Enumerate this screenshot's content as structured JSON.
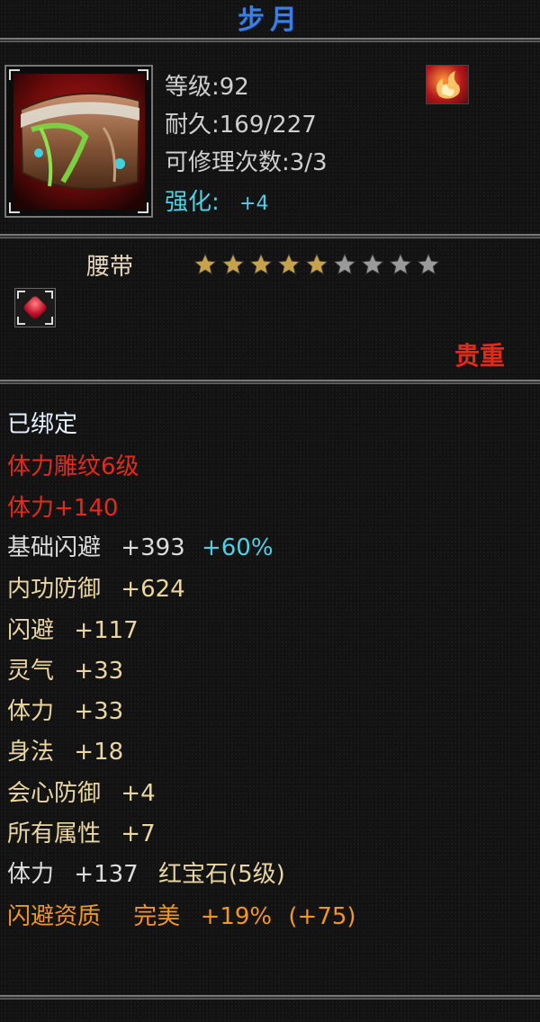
{
  "item": {
    "name": "步月",
    "type": "腰带",
    "rarity": "贵重",
    "stats": {
      "level": "等级:92",
      "durability": "耐久:169/227",
      "repairs": "可修理次数:3/3",
      "refine_label": "强化:",
      "refine_value": "+4"
    },
    "stars_total": 9,
    "stars_filled": 5,
    "colors": {
      "title": "#3b7fe0",
      "red": "#e42a1e",
      "cyan": "#4fd0e6",
      "yellow": "#e9d6a0",
      "orange": "#f0962a",
      "star_gold": "#c8a24a",
      "star_grey": "#9a9a9a"
    },
    "icons": {
      "item": "belt-icon",
      "skill": "flame-icon",
      "gem_slot": "ruby-gem-icon"
    }
  },
  "attributes": {
    "bound": "已绑定",
    "engrave": "体力雕纹6级",
    "engrave_bonus": "体力+140",
    "base_dodge_label": "基础闪避",
    "base_dodge_value": "+393",
    "base_dodge_pct": "+60%",
    "inner_def_label": "内功防御",
    "inner_def_value": "+624",
    "dodge_label": "闪避",
    "dodge_value": "+117",
    "spirit_label": "灵气",
    "spirit_value": "+33",
    "stamina_label": "体力",
    "stamina_value": "+33",
    "agility_label": "身法",
    "agility_value": "+18",
    "crit_def_label": "会心防御",
    "crit_def_value": "+4",
    "all_attr_label": "所有属性",
    "all_attr_value": "+7",
    "gem_label": "体力",
    "gem_value": "+137",
    "gem_name": "红宝石(5级)",
    "aptitude_label": "闪避资质",
    "aptitude_grade": "完美",
    "aptitude_pct": "+19%",
    "aptitude_extra": "(+75)"
  }
}
